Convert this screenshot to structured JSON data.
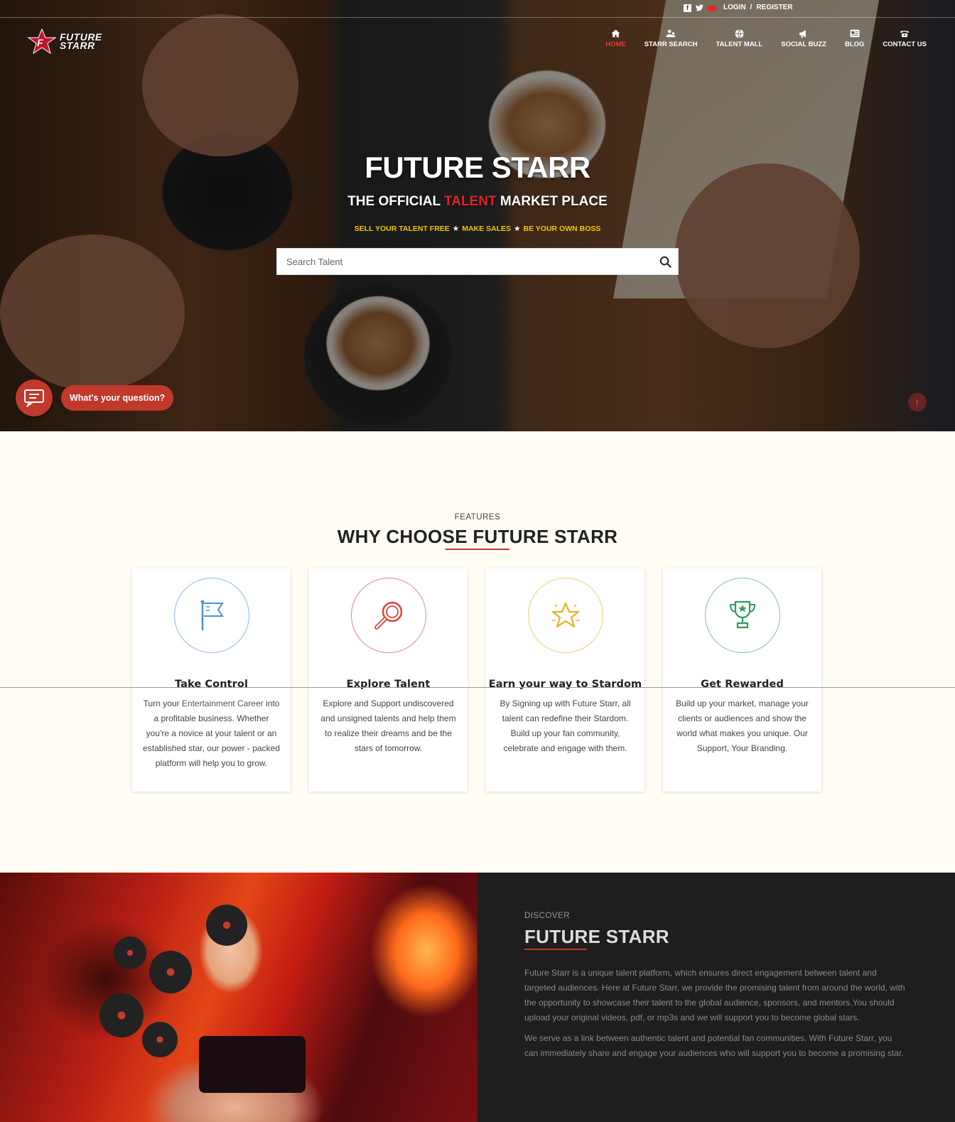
{
  "topbar": {
    "social_icons": [
      "facebook-icon",
      "twitter-icon",
      "youtube-icon"
    ],
    "login": "LOGIN",
    "separator": "/",
    "register": "REGISTER"
  },
  "logo": {
    "line1": "FUTURE",
    "line2": "STARR"
  },
  "nav": [
    {
      "label": "HOME",
      "icon": "home-icon",
      "active": true
    },
    {
      "label": "STARR SEARCH",
      "icon": "users-icon",
      "active": false
    },
    {
      "label": "TALENT MALL",
      "icon": "globe-icon",
      "active": false
    },
    {
      "label": "SOCIAL BUZZ",
      "icon": "megaphone-icon",
      "active": false
    },
    {
      "label": "BLOG",
      "icon": "blog-icon",
      "active": false
    },
    {
      "label": "CONTACT US",
      "icon": "phone-icon",
      "active": false
    }
  ],
  "hero": {
    "title": "FUTURE STARR",
    "subtitle_pre": "THE OFFICIAL",
    "subtitle_accent": "TALENT",
    "subtitle_post": "MARKET PLACE",
    "tag1": "SELL YOUR TALENT FREE",
    "tag2": "MAKE SALES",
    "tag3": "BE YOUR OWN BOSS",
    "search_placeholder": "Search Talent"
  },
  "chat": {
    "label": "What's your question?"
  },
  "features": {
    "kicker": "FEATURES",
    "title": "WHY CHOOSE FUTURE STARR",
    "cards": [
      {
        "icon": "flag-icon",
        "color": "#4a90e2",
        "title": "Take Control",
        "text_pre": "Turn your ",
        "text_hl": "Entertainment Career",
        "text_post": " into a profitable business. Whether you're a novice at your talent or an established star, our power - packed platform will help you to grow."
      },
      {
        "icon": "magnifier-icon",
        "color": "#d9453a",
        "title": "Explore Talent",
        "text_pre": "Explore and Support undiscovered and unsigned talents and help them to realize their dreams and be the stars of tomorrow.",
        "text_hl": "",
        "text_post": ""
      },
      {
        "icon": "star-icon",
        "color": "#e8b21e",
        "title": "Earn your way to Stardom",
        "text_pre": "By Signing up with Future Starr, all talent can redefine their Stardom. Build up your fan community, celebrate and engage with them.",
        "text_hl": "",
        "text_post": ""
      },
      {
        "icon": "trophy-icon",
        "color": "#2e9c5a",
        "title": "Get Rewarded",
        "text_pre": "Build up your market, manage your clients or audiences and show the world what makes you unique. Our Support, Your Branding.",
        "text_hl": "",
        "text_post": ""
      }
    ]
  },
  "discover": {
    "kicker": "DISCOVER",
    "title": "FUTURE STARR",
    "para1": "Future Starr is a unique talent platform, which ensures direct engagement between talent and targeted audiences. Here at Future Starr, we provide the promising talent from around the world, with the opportunity to showcase their talent to the global audience, sponsors, and mentors.You should upload your original videos, pdf, or mp3s and we will support you to become global stars.",
    "para2": "We serve as a link between authentic talent and potential fan communities. With Future Starr, you can immediately share and engage your audiences who will support you to become a promising star."
  }
}
